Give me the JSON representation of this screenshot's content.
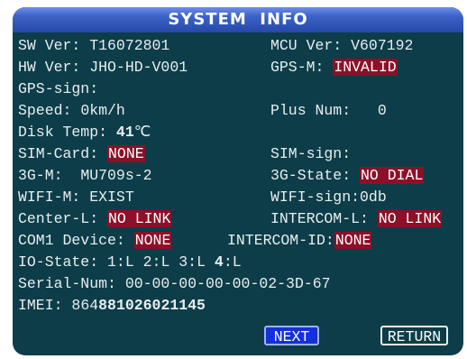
{
  "title": "SYSTEM  INFO",
  "rows": {
    "sw_ver": {
      "label": "SW Ver: ",
      "value": "T16072801"
    },
    "mcu_ver": {
      "label": "MCU Ver: ",
      "value": "V607192"
    },
    "hw_ver": {
      "label": "HW Ver: ",
      "value": "JHO-HD-V001"
    },
    "gps_m": {
      "label": "GPS-M: ",
      "value": "INVALID"
    },
    "gps_sign": {
      "label": "GPS-sign:"
    },
    "speed": {
      "label": "Speed: ",
      "value": "0km/h"
    },
    "plus_num": {
      "label": "Plus Num:   ",
      "value": "0"
    },
    "disk_temp": {
      "label": "Disk Temp: ",
      "value": "41",
      "unit": "℃"
    },
    "sim_card": {
      "label": "SIM-Card: ",
      "value": "NONE"
    },
    "sim_sign": {
      "label": "SIM-sign:"
    },
    "g3_m": {
      "label": "3G-M:  ",
      "value": "MU709s-2"
    },
    "g3_state": {
      "label": "3G-State: ",
      "value": "NO DIAL"
    },
    "wifi_m": {
      "label": "WIFI-M: ",
      "value": "EXIST"
    },
    "wifi_sign": {
      "label": "WIFI-sign:",
      "value": "0db"
    },
    "center_l": {
      "label": "Center-L: ",
      "value": "NO LINK"
    },
    "intercom_l": {
      "label": "INTERCOM-L: ",
      "value": "NO LINK"
    },
    "com1_device": {
      "label": "COM1 Device: ",
      "value": "NONE"
    },
    "intercom_id": {
      "label": "INTERCOM-ID:",
      "value": "NONE"
    },
    "io_state": {
      "label": "IO-State: ",
      "p1": "1:L",
      "p2": "2:L",
      "p3": "3:L",
      "p4num": "4",
      "p4state": ":L"
    },
    "serial_num": {
      "label": "Serial-Num: ",
      "value": "00-00-00-00-00-02-3D-67"
    },
    "imei": {
      "label": "IMEI: ",
      "value_a": "864",
      "value_b": "881026021145"
    }
  },
  "buttons": {
    "next": "NEXT",
    "return": "RETURN"
  },
  "colors": {
    "panel_bg": "#0d3d48",
    "title_bar": "#3d63c9",
    "badge": "#8c1028",
    "next_button": "#1430d8",
    "text": "#e8eef0"
  }
}
